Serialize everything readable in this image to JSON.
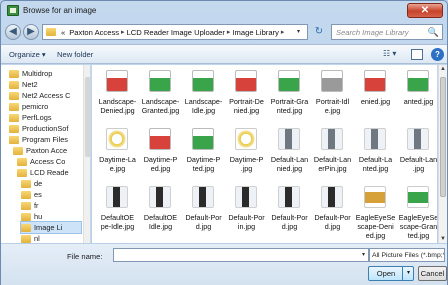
{
  "window": {
    "title": "Browse for an image",
    "close_glyph": "✕"
  },
  "address": {
    "back_glyph": "◀",
    "fwd_glyph": "▶",
    "prefix": "«",
    "crumbs": [
      "Paxton Access",
      "LCD Reader Image Uploader",
      "Image Library"
    ],
    "separator": "▸",
    "refresh_glyph": "↻",
    "drop_glyph": "▾"
  },
  "search": {
    "placeholder": "Search Image Library",
    "icon": "🔍"
  },
  "toolbar": {
    "organize": "Organize ▾",
    "new_folder": "New folder",
    "views": "☷ ▾",
    "help": "?"
  },
  "tree": [
    {
      "label": "Multidrop",
      "indent": 0
    },
    {
      "label": "Net2",
      "indent": 0
    },
    {
      "label": "Net2 Access C",
      "indent": 0
    },
    {
      "label": "pemicro",
      "indent": 0
    },
    {
      "label": "PerfLogs",
      "indent": 0
    },
    {
      "label": "ProductionSof",
      "indent": 0
    },
    {
      "label": "Program Files",
      "indent": 0
    },
    {
      "label": "Paxton Acce",
      "indent": 1
    },
    {
      "label": "Access Co",
      "indent": 2
    },
    {
      "label": "LCD Reade",
      "indent": 2
    },
    {
      "label": "de",
      "indent": 3
    },
    {
      "label": "es",
      "indent": 3
    },
    {
      "label": "fr",
      "indent": 3
    },
    {
      "label": "hu",
      "indent": 3
    },
    {
      "label": "Image Li",
      "indent": 3,
      "selected": true
    },
    {
      "label": "nl",
      "indent": 3
    }
  ],
  "files": [
    {
      "label": "Landscape-\nDenied.jpg",
      "kind": "badge",
      "color": "#d7423a"
    },
    {
      "label": "Landscape-\nGranted.jpg",
      "kind": "badge",
      "color": "#3aa44a"
    },
    {
      "label": "Landscape-\nIdle.jpg",
      "kind": "badge",
      "color": "#3aa44a"
    },
    {
      "label": "Portrait-De\nnied.jpg",
      "kind": "badge",
      "color": "#d7423a"
    },
    {
      "label": "Portrait-Gra\nnted.jpg",
      "kind": "badge",
      "color": "#3aa44a"
    },
    {
      "label": "Portrait-Idl\ne.jpg",
      "kind": "badge",
      "color": "#9a9a9a"
    },
    {
      "label": "enied.jpg",
      "kind": "badge",
      "color": "#d7423a"
    },
    {
      "label": "anted.jpg",
      "kind": "badge",
      "color": "#3aa44a"
    },
    {
      "label": "Daytime-La\ne.jpg",
      "kind": "clock",
      "color": "#e8c840"
    },
    {
      "label": "Daytime-P\ned.jpg",
      "kind": "badge",
      "color": "#d7423a"
    },
    {
      "label": "Daytime-P\nted.jpg",
      "kind": "badge",
      "color": "#3aa44a"
    },
    {
      "label": "Daytime-P\n.jpg",
      "kind": "clock",
      "color": "#e8c840"
    },
    {
      "label": "Default-Lan\nnied.jpg",
      "kind": "reader",
      "color": "#6f7780"
    },
    {
      "label": "Default-Lan\nerPin.jpg",
      "kind": "reader",
      "color": "#6f7780"
    },
    {
      "label": "Default-La\nnted.jpg",
      "kind": "reader",
      "color": "#6f7780"
    },
    {
      "label": "Default-Lan\n.jpg",
      "kind": "reader",
      "color": "#6f7780"
    },
    {
      "label": "DefaultOE\npe-Idle.jpg",
      "kind": "reader",
      "color": "#2b2b2b"
    },
    {
      "label": "DefaultOE\nIdle.jpg",
      "kind": "reader",
      "color": "#2b2b2b"
    },
    {
      "label": "Default-Por\nd.jpg",
      "kind": "reader",
      "color": "#2b2b2b"
    },
    {
      "label": "Default-Por\nin.jpg",
      "kind": "reader",
      "color": "#2b2b2b"
    },
    {
      "label": "Default-Por\nd.jpg",
      "kind": "reader",
      "color": "#2b2b2b"
    },
    {
      "label": "Default-Por\nd.jpg",
      "kind": "reader",
      "color": "#2b2b2b"
    },
    {
      "label": "EagleEyeSe\nscape-Deni\ned.jpg",
      "kind": "lock",
      "color": "#d7a13a"
    },
    {
      "label": "EagleEyeSe\nscape-Gran\nted.jpg",
      "kind": "lock",
      "color": "#3aa44a"
    }
  ],
  "bottom": {
    "file_name_label": "File name:",
    "file_name_value": "",
    "filter": "All Picture Files (*.bmp;*.jpg;*.j ▾",
    "open": "Open",
    "open_split": "▾",
    "cancel": "Cancel"
  }
}
